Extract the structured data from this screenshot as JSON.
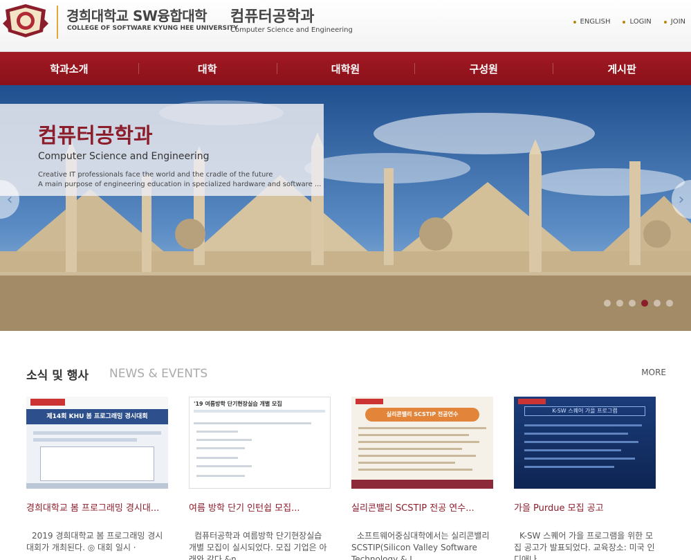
{
  "header": {
    "university_ko": "경희대학교 SW융합대학",
    "university_en": "COLLEGE OF SOFTWARE KYUNG HEE UNIVERSITY",
    "department_ko": "컴퓨터공학과",
    "department_en": "Computer Science and Engineering",
    "utility_links": [
      "ENGLISH",
      "LOGIN",
      "JOIN"
    ]
  },
  "nav": {
    "items": [
      "학과소개",
      "대학",
      "대학원",
      "구성원",
      "게시판"
    ]
  },
  "hero": {
    "title": "컴퓨터공학과",
    "subtitle": "Computer Science and Engineering",
    "desc_line1": "Creative IT professionals face the world and the cradle of the future",
    "desc_line2": "A main purpose of engineering education in specialized hardware and software ...",
    "prev_arrow": "‹",
    "next_arrow": "›",
    "slide_count": 6,
    "active_slide": 4
  },
  "news": {
    "heading_ko": "소식 및 행사",
    "heading_en": "NEWS & EVENTS",
    "more_label": "MORE",
    "cards": [
      {
        "title": "경희대학교 봄 프로그래밍 경시대...",
        "excerpt": "2019 경희대학교 봄 프로그래밍 경시대회가 개최된다. ◎ 대회 일시 ·",
        "thumb_heading": "제14회 KHU 봄 프로그래밍 경시대회"
      },
      {
        "title": "여름 방학 단기 인턴쉽 모집...",
        "excerpt": "컴퓨터공학과 여름방학 단기현장실습 개별 모집이 실시되었다. 모집 기업은 아래와 같다.&n...",
        "thumb_heading": "'19 여름방학 단기현장실습 개별 모집"
      },
      {
        "title": "실리콘밸리 SCSTIP 전공 연수...",
        "excerpt": "소프트웨어중심대학에서는 실리콘밸리 SCSTIP(Silicon Valley Software Technology & I...",
        "thumb_heading": "실리콘밸리 SCSTIP 전공연수"
      },
      {
        "title": "가을 Purdue 모집 공고",
        "excerpt": "K-SW 스퀘어 가을 프로그램을 위한 모집 공고가 발표되었다. 교육장소: 미국 인디애나...",
        "thumb_heading": "K-SW 스퀘어 가을 프로그램"
      }
    ]
  },
  "colors": {
    "brand_red": "#8c1d2b",
    "nav_red": "#a11a24",
    "accent_gold": "#e1a83a"
  }
}
